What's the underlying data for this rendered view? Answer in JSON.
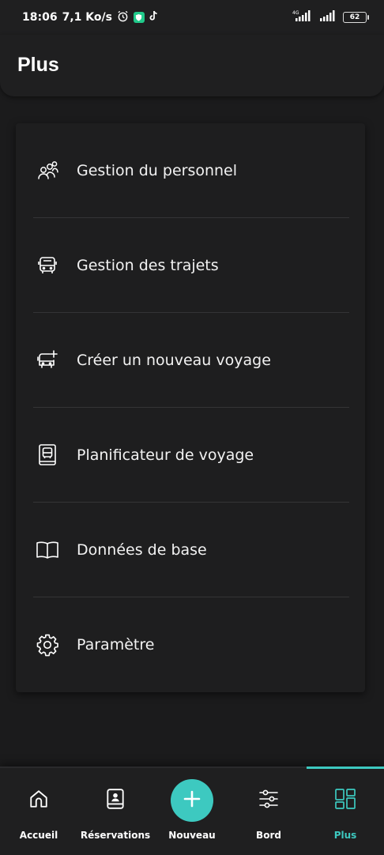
{
  "status_bar": {
    "time": "18:06",
    "speed": "7,1 Ko/s",
    "network": "4G",
    "battery": "62"
  },
  "header": {
    "title": "Plus"
  },
  "menu": {
    "items": [
      {
        "label": "Gestion du personnel",
        "icon": "people-group-icon"
      },
      {
        "label": "Gestion des trajets",
        "icon": "bus-icon"
      },
      {
        "label": "Créer un nouveau voyage",
        "icon": "bus-add-icon"
      },
      {
        "label": "Planificateur de voyage",
        "icon": "bus-book-icon"
      },
      {
        "label": "Données de base",
        "icon": "open-book-icon"
      },
      {
        "label": "Paramètre",
        "icon": "gear-icon"
      }
    ]
  },
  "bottom_nav": {
    "items": [
      {
        "label": "Accueil",
        "icon": "home-icon"
      },
      {
        "label": "Réservations",
        "icon": "booking-icon"
      },
      {
        "label": "Nouveau",
        "icon": "plus-icon"
      },
      {
        "label": "Bord",
        "icon": "sliders-icon"
      },
      {
        "label": "Plus",
        "icon": "grid-icon",
        "active": true
      }
    ],
    "accent_color": "#3dc9c0"
  }
}
